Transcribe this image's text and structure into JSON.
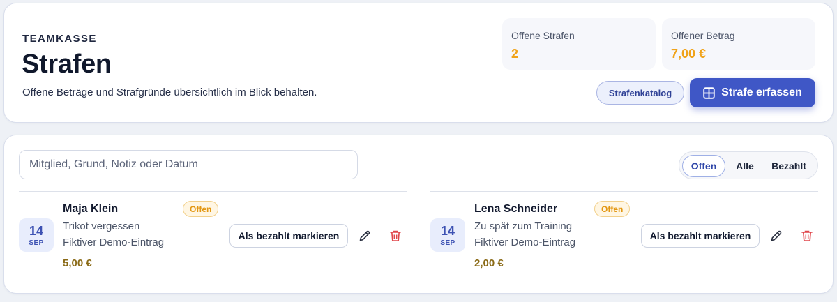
{
  "header": {
    "eyebrow": "TEAMKASSE",
    "title": "Strafen",
    "subtitle": "Offene Beträge und Strafgründe übersichtlich im Blick behalten.",
    "stats": [
      {
        "label": "Offene Strafen",
        "value": "2"
      },
      {
        "label": "Offener Betrag",
        "value": "7,00 €"
      }
    ],
    "catalog_button": "Strafenkatalog",
    "primary_button": "Strafe erfassen"
  },
  "search": {
    "placeholder": "Mitglied, Grund, Notiz oder Datum",
    "value": ""
  },
  "filters": {
    "options": [
      "Offen",
      "Alle",
      "Bezahlt"
    ],
    "selected": "Offen"
  },
  "entries": [
    {
      "day": "14",
      "month": "SEP",
      "name": "Maja Klein",
      "status": "Offen",
      "reason": "Trikot vergessen",
      "note": "Fiktiver Demo-Eintrag",
      "amount": "5,00 €",
      "action": "Als bezahlt markieren"
    },
    {
      "day": "14",
      "month": "SEP",
      "name": "Lena Schneider",
      "status": "Offen",
      "reason": "Zu spät zum Training",
      "note": "Fiktiver Demo-Eintrag",
      "amount": "2,00 €",
      "action": "Als bezahlt markieren"
    }
  ],
  "icons": {
    "primary_button": "grid-plus-icon",
    "edit": "pencil-icon",
    "delete": "trash-icon"
  },
  "colors": {
    "accent": "#3f57c6",
    "warning": "#f0a31a",
    "danger": "#e0454a",
    "amount": "#8a6a16"
  }
}
